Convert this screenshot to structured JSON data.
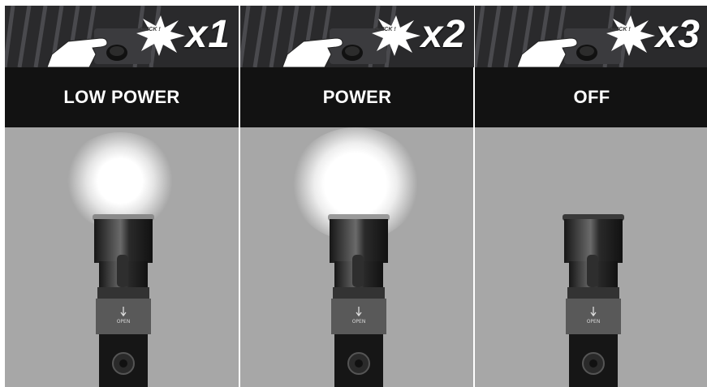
{
  "panels": [
    {
      "multiplier": "x1",
      "click_text": "CLICK !",
      "mode": "LOW POWER",
      "light": "low"
    },
    {
      "multiplier": "x2",
      "click_text": "CLICK !",
      "mode": "POWER",
      "light": "high"
    },
    {
      "multiplier": "x3",
      "click_text": "CLICK !",
      "mode": "OFF",
      "light": "off"
    }
  ],
  "torch_marking": "OPEN",
  "colors": {
    "banner": "#2a2a2c",
    "label_bar": "#121212",
    "scene": "#a7a7a7",
    "label_text": "#ffffff"
  },
  "icons": [
    "hand-press-icon",
    "click-burst-icon",
    "flashlight-icon",
    "light-beam-icon"
  ]
}
